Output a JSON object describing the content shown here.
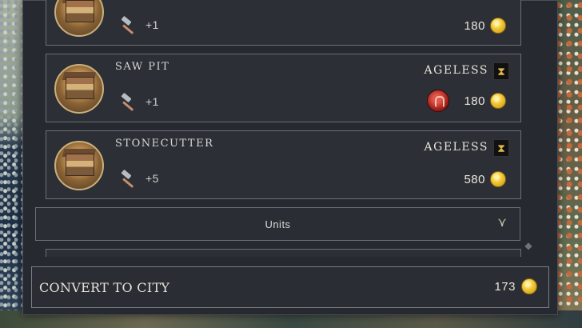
{
  "buildings": [
    {
      "name": "",
      "age": "",
      "production": "+1",
      "cost": "180",
      "faith": false
    },
    {
      "name": "SAW PIT",
      "age": "AGELESS",
      "production": "+1",
      "cost": "180",
      "faith": true
    },
    {
      "name": "STONECUTTER",
      "age": "AGELESS",
      "production": "+5",
      "cost": "580",
      "faith": false
    }
  ],
  "units_section": {
    "label": "Units"
  },
  "convert": {
    "label": "CONVERT TO CITY",
    "cost": "173"
  },
  "colors": {
    "panel": "#262930",
    "card": "#2c2f36",
    "border": "#6c6f74",
    "gold": "#f2c935",
    "text": "#e6e3d8"
  },
  "icons": {
    "production": "hammer-icon",
    "currency": "gold-coin-icon",
    "ageless": "hourglass-icon",
    "expand": "chevron-down-icon"
  }
}
